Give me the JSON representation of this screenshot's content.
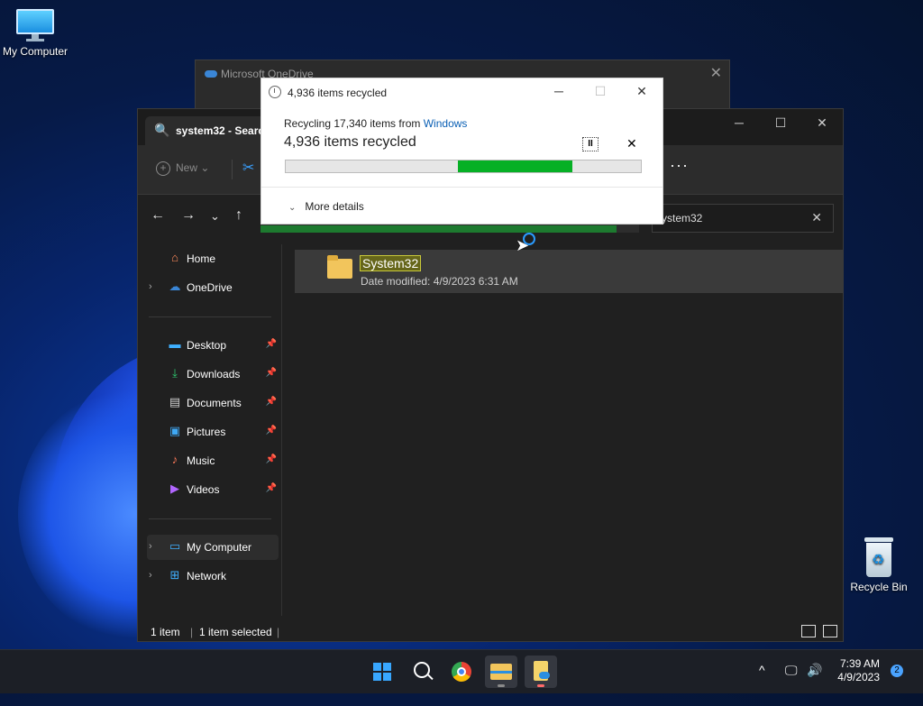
{
  "desktop": {
    "icons": [
      {
        "label": "My Computer"
      },
      {
        "label": "Recycle Bin"
      }
    ]
  },
  "onedrive_window": {
    "title": "Microsoft OneDrive",
    "close": "✕"
  },
  "explorer": {
    "tab_label": "system32 - Search",
    "window_controls": {
      "minimize": "─",
      "maximize": "☐",
      "close": "✕"
    },
    "toolbar": {
      "new_label": "New",
      "new_plus": "+",
      "new_caret": "⌄",
      "cut_icon": "✂",
      "more": "···"
    },
    "nav": {
      "back": "←",
      "forward": "→",
      "recent": "⌄",
      "up": "↑"
    },
    "search": {
      "value": "ystem32",
      "clear": "✕"
    },
    "sidebar": {
      "chevron": "›",
      "pin": "📌",
      "top": [
        {
          "label": "Home",
          "icon": "home-icon",
          "glyph": "⌂",
          "color": "#ff8a5c"
        },
        {
          "label": "OneDrive",
          "icon": "cloud-icon",
          "glyph": "☁",
          "color": "#3a86d6"
        }
      ],
      "quick": [
        {
          "label": "Desktop",
          "icon": "desktop-icon",
          "glyph": "▬",
          "color": "#3fb0ff"
        },
        {
          "label": "Downloads",
          "icon": "download-icon",
          "glyph": "⤓",
          "color": "#2ecc71"
        },
        {
          "label": "Documents",
          "icon": "document-icon",
          "glyph": "▤",
          "color": "#cfcfcf"
        },
        {
          "label": "Pictures",
          "icon": "picture-icon",
          "glyph": "▣",
          "color": "#3fa9f5"
        },
        {
          "label": "Music",
          "icon": "music-icon",
          "glyph": "♪",
          "color": "#ff7a59"
        },
        {
          "label": "Videos",
          "icon": "video-icon",
          "glyph": "▶",
          "color": "#b266ff"
        }
      ],
      "bottom": [
        {
          "label": "My Computer",
          "icon": "computer-icon",
          "glyph": "▭",
          "color": "#3fb0ff"
        },
        {
          "label": "Network",
          "icon": "network-icon",
          "glyph": "⊞",
          "color": "#3fb0ff"
        }
      ]
    },
    "result": {
      "name": "System32",
      "date": "Date modified: 4/9/2023 6:31 AM"
    },
    "status": {
      "count": "1 item",
      "selected": "1 item selected",
      "separator": "|"
    }
  },
  "dialog": {
    "title": "4,936 items recycled",
    "window_controls": {
      "minimize": "─",
      "maximize": "☐",
      "close": "✕"
    },
    "subtitle_prefix": "Recycling 17,340 items from ",
    "subtitle_link": "Windows",
    "main_text": "4,936 items recycled",
    "pause": "II",
    "cancel": "✕",
    "progress": {
      "start_fraction": 0.485,
      "end_fraction": 0.808,
      "fill_color": "#06b025"
    },
    "more_details": "More details",
    "more_chevron": "⌄"
  },
  "taskbar": {
    "time": "7:39 AM",
    "date": "4/9/2023",
    "notifications": "2",
    "tray": {
      "chevron": "^",
      "display": "🖵",
      "volume": "🔊"
    }
  }
}
